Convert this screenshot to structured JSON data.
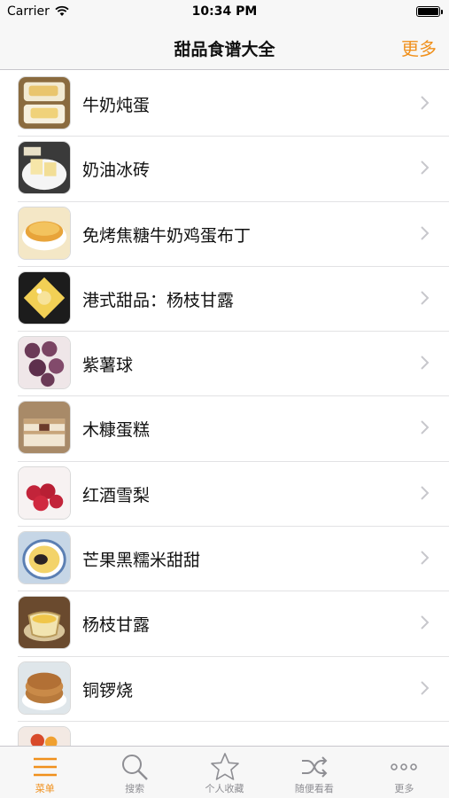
{
  "status_bar": {
    "carrier": "Carrier",
    "time": "10:34 PM"
  },
  "nav": {
    "title": "甜品食谱大全",
    "more_label": "更多"
  },
  "colors": {
    "accent": "#f0901c",
    "inactive": "#8e8e93"
  },
  "recipes": [
    {
      "label": "牛奶炖蛋"
    },
    {
      "label": "奶油冰砖"
    },
    {
      "label": "免烤焦糖牛奶鸡蛋布丁"
    },
    {
      "label": "港式甜品：杨枝甘露"
    },
    {
      "label": "紫薯球"
    },
    {
      "label": "木糠蛋糕"
    },
    {
      "label": "红酒雪梨"
    },
    {
      "label": "芒果黑糯米甜甜"
    },
    {
      "label": "杨枝甘露"
    },
    {
      "label": "铜锣烧"
    },
    {
      "label": ""
    }
  ],
  "tabs": [
    {
      "label": "菜单",
      "icon": "menu-icon",
      "active": true
    },
    {
      "label": "搜索",
      "icon": "search-icon",
      "active": false
    },
    {
      "label": "个人收藏",
      "icon": "star-icon",
      "active": false
    },
    {
      "label": "随便看看",
      "icon": "shuffle-icon",
      "active": false
    },
    {
      "label": "更多",
      "icon": "more-icon",
      "active": false
    }
  ]
}
